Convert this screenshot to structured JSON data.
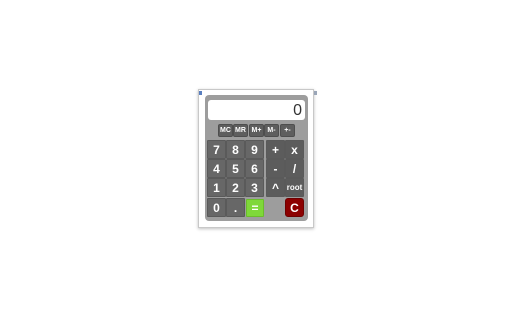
{
  "display": {
    "value": "0"
  },
  "memory_keys": [
    "MC",
    "MR",
    "M+",
    "M-",
    "+-"
  ],
  "keys": {
    "seven": "7",
    "eight": "8",
    "nine": "9",
    "plus": "+",
    "multiply": "x",
    "four": "4",
    "five": "5",
    "six": "6",
    "minus": "-",
    "divide": "/",
    "one": "1",
    "two": "2",
    "three": "3",
    "power": "^",
    "root": "root",
    "zero": "0",
    "decimal": ".",
    "equals": "=",
    "clear": "C"
  },
  "colors": {
    "body": "#9d9d9d",
    "key": "#676767",
    "equals": "#7fd83a",
    "clear": "#8c0000"
  }
}
